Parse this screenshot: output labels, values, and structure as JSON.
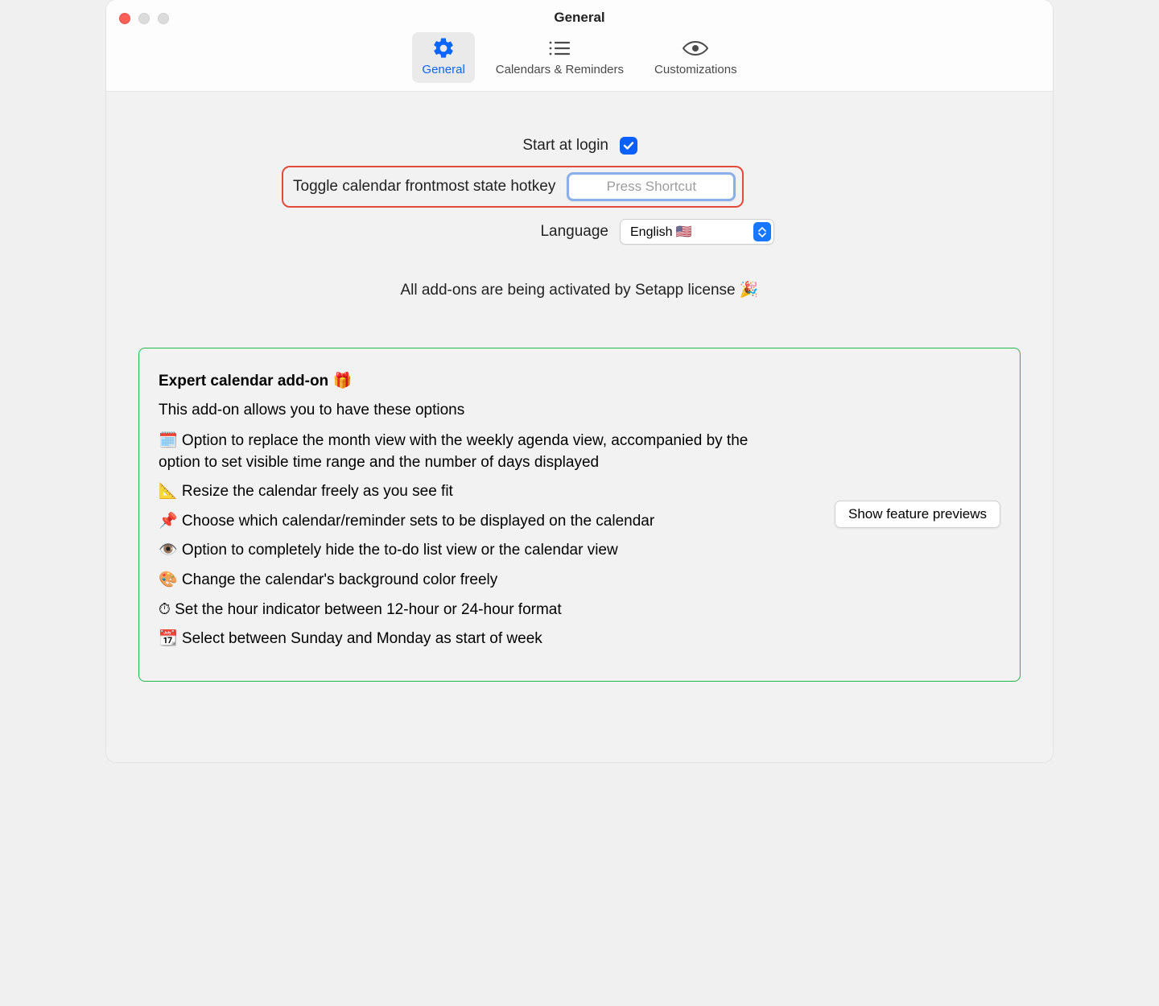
{
  "window": {
    "title": "General"
  },
  "tabs": {
    "general": "General",
    "calendars": "Calendars & Reminders",
    "customizations": "Customizations"
  },
  "settings": {
    "start_at_login_label": "Start at login",
    "start_at_login_checked": "true",
    "hotkey_label": "Toggle calendar frontmost state hotkey",
    "hotkey_placeholder": "Press Shortcut",
    "language_label": "Language",
    "language_value": "English 🇺🇸"
  },
  "license_text": "All add-ons are being activated by Setapp license 🎉",
  "addon": {
    "title": "Expert calendar add-on 🎁",
    "description": "This add-on allows you to have these options",
    "items": [
      "🗓️ Option to replace the month view with the weekly agenda view, accompanied by the option to set visible time range and the number of days displayed",
      "📐 Resize the calendar freely as you see fit",
      "📌 Choose which calendar/reminder sets to be displayed on the calendar",
      "👁️ Option to completely hide the to-do list view or the calendar view",
      "🎨 Change the calendar's background color freely",
      "⏱ Set the hour indicator between 12-hour or 24-hour format",
      "📆 Select between Sunday and Monday as start of week"
    ],
    "preview_button": "Show feature previews"
  }
}
